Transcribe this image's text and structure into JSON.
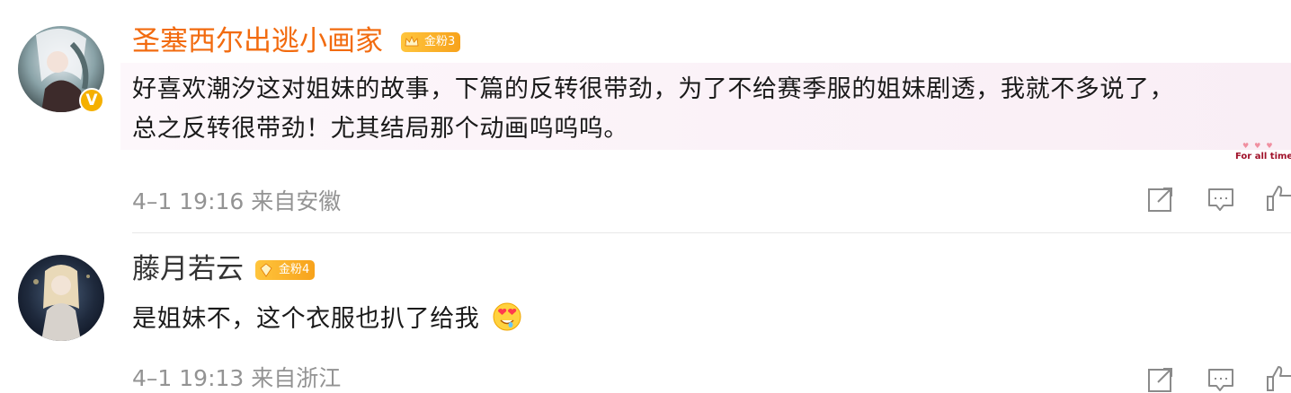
{
  "comments": [
    {
      "username": "圣塞西尔出逃小画家",
      "username_color": "#f26b0f",
      "badge": "金粉3",
      "verified": "V",
      "text_lines": [
        "好喜欢潮汐这对姐妹的故事，下篇的反转很带劲，为了不给赛季服的姐妹剧透，我就不多说了，",
        "总之反转很带劲！尤其结局那个动画呜呜呜。"
      ],
      "bubble_tag": "For all time",
      "meta": "4–1 19:16  来自安徽"
    },
    {
      "username": "藤月若云",
      "username_color": "#333333",
      "badge": "金粉4",
      "text": "是姐妹不，这个衣服也扒了给我",
      "emoji": "heart-eyes-emoji",
      "meta": "4–1 19:13  来自浙江"
    }
  ],
  "icons": {
    "share": "share-icon",
    "comment": "comment-icon",
    "like": "like-icon"
  }
}
